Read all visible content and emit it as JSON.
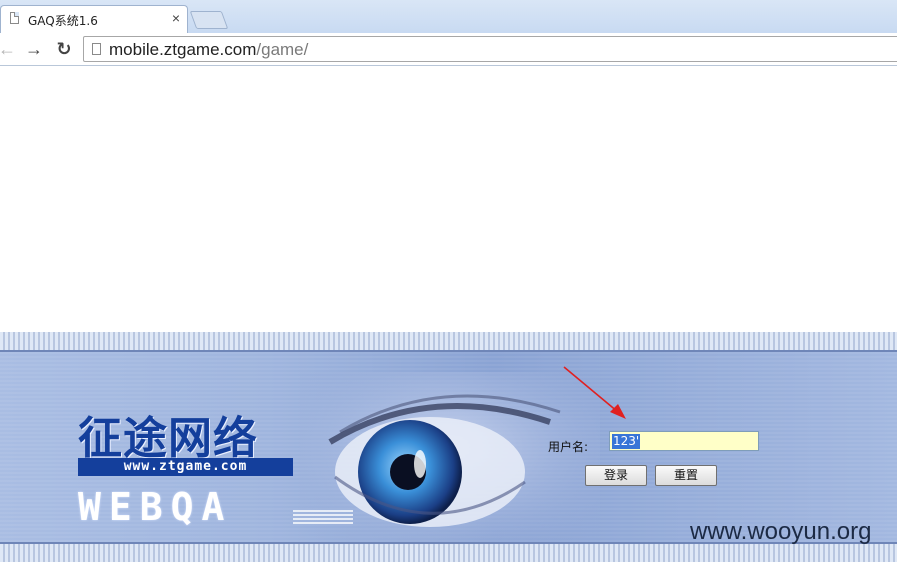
{
  "browser": {
    "tab_title": "GAQ系统1.6",
    "close_glyph": "×",
    "url_host": "mobile.ztgame.com",
    "url_path": "/game/"
  },
  "login": {
    "username_label": "用户名:",
    "username_value": "123'",
    "login_button": "登录",
    "reset_button": "重置"
  },
  "logo": {
    "chinese": "征途网络",
    "website": "www.ztgame.com",
    "brand": "WEBQA"
  },
  "watermark": "www.wooyun.org",
  "colors": {
    "input_bg": "#ffffc8",
    "logo_blue": "#143f9c",
    "arrow_red": "#e02020"
  }
}
